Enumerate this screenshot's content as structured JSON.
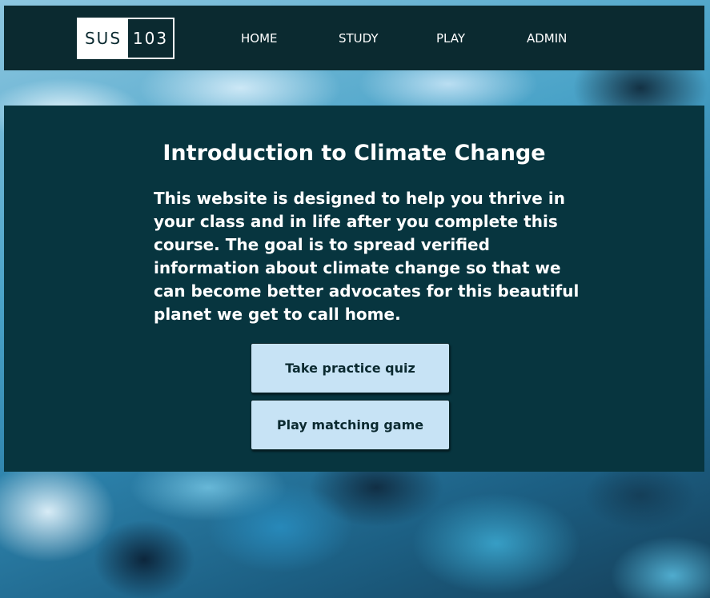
{
  "nav": {
    "logo": {
      "left_text": "SUS",
      "right_text": "103"
    },
    "items": [
      {
        "label": "HOME"
      },
      {
        "label": "STUDY"
      },
      {
        "label": "PLAY"
      },
      {
        "label": "ADMIN"
      }
    ]
  },
  "main": {
    "title": "Introduction to Climate Change",
    "description": "This website is designed to help you thrive in your class and in life after you complete this course. The goal is to spread verified information about climate change so that we can become better advocates for this beautiful planet we get to call home.",
    "buttons": {
      "quiz_label": "Take practice quiz",
      "game_label": "Play matching game"
    }
  },
  "colors": {
    "navbar_bg": "#0b2a30",
    "panel_bg": "#07353f",
    "button_bg": "#c7e3f5",
    "text_light": "#ffffff"
  },
  "background": {
    "image_icon": "arctic-ice-satellite-photo"
  }
}
